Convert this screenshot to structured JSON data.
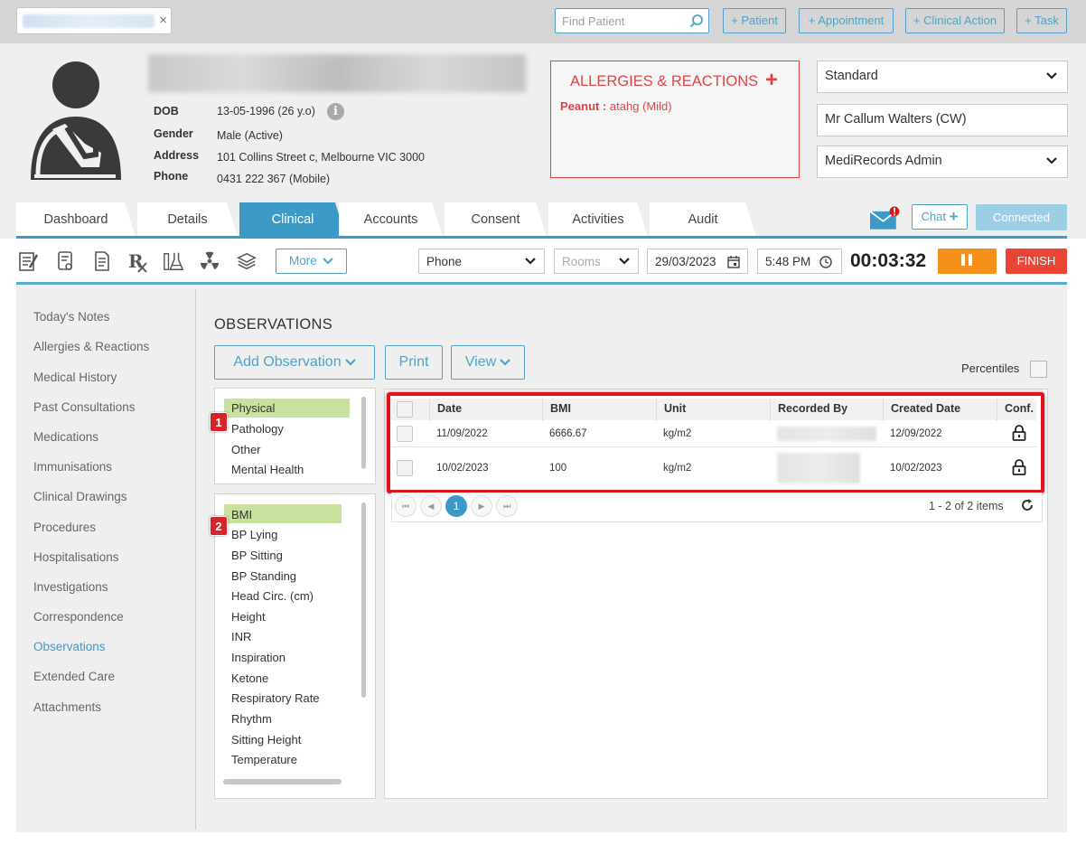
{
  "topbar": {
    "search_placeholder": "Find Patient",
    "buttons": [
      "+ Patient",
      "+ Appointment",
      "+ Clinical Action",
      "+ Task"
    ]
  },
  "patient": {
    "fields": [
      {
        "label": "DOB",
        "value": "13-05-1996 (26 y.o)"
      },
      {
        "label": "Gender",
        "value": "Male (Active)"
      },
      {
        "label": "Address",
        "value": "101 Collins Street c, Melbourne VIC 3000"
      },
      {
        "label": "Phone",
        "value": "0431 222 367 (Mobile)"
      }
    ]
  },
  "allergies": {
    "title": "ALLERGIES & REACTIONS",
    "add_icon": "plus-icon",
    "items": [
      {
        "name": "Peanut :",
        "detail": "atahg (Mild)"
      }
    ]
  },
  "side_selects": {
    "template": "Standard",
    "practitioner": "Mr Callum Walters (CW)",
    "location": "MediRecords Admin"
  },
  "tabs": [
    "Dashboard",
    "Details",
    "Clinical",
    "Accounts",
    "Consent",
    "Activities",
    "Audit"
  ],
  "active_tab": "Clinical",
  "chat": {
    "label": "Chat",
    "status": "Connected"
  },
  "encounter": {
    "more_label": "More",
    "type": "Phone",
    "rooms_placeholder": "Rooms",
    "date": "29/03/2023",
    "time": "5:48 PM",
    "timer": "00:03:32",
    "finish_label": "FINISH"
  },
  "left_nav": {
    "items": [
      "Today's Notes",
      "Allergies & Reactions",
      "Medical History",
      "Past Consultations",
      "Medications",
      "Immunisations",
      "Clinical Drawings",
      "Procedures",
      "Hospitalisations",
      "Investigations",
      "Correspondence",
      "Observations",
      "Extended Care",
      "Attachments"
    ],
    "active": "Observations"
  },
  "observations": {
    "title": "OBSERVATIONS",
    "add_label": "Add Observation",
    "print_label": "Print",
    "view_label": "View",
    "percentiles_label": "Percentiles",
    "categories": [
      "Physical",
      "Pathology",
      "Other",
      "Mental Health"
    ],
    "selected_category": "Physical",
    "types": [
      "BMI",
      "BP Lying",
      "BP Sitting",
      "BP Standing",
      "Head Circ. (cm)",
      "Height",
      "INR",
      "Inspiration",
      "Ketone",
      "Respiratory Rate",
      "Rhythm",
      "Sitting Height",
      "Temperature"
    ],
    "selected_type": "BMI",
    "badges": [
      "1",
      "2"
    ]
  },
  "grid": {
    "columns": [
      "Date",
      "BMI",
      "Unit",
      "Recorded By",
      "Created Date",
      "Conf."
    ],
    "rows": [
      {
        "date": "11/09/2022",
        "bmi": "6666.67",
        "unit": "kg/m2",
        "created": "12/09/2022"
      },
      {
        "date": "10/02/2023",
        "bmi": "100",
        "unit": "kg/m2",
        "created": "10/02/2023"
      }
    ],
    "page": "1",
    "pager_info": "1 - 2 of 2 items"
  },
  "colors": {
    "accent": "#3d9ac6",
    "allergy": "#e04545",
    "highlight": "#c9e19e",
    "pause": "#f39018",
    "finish": "#ea4436",
    "annotation": "#e0121a"
  }
}
